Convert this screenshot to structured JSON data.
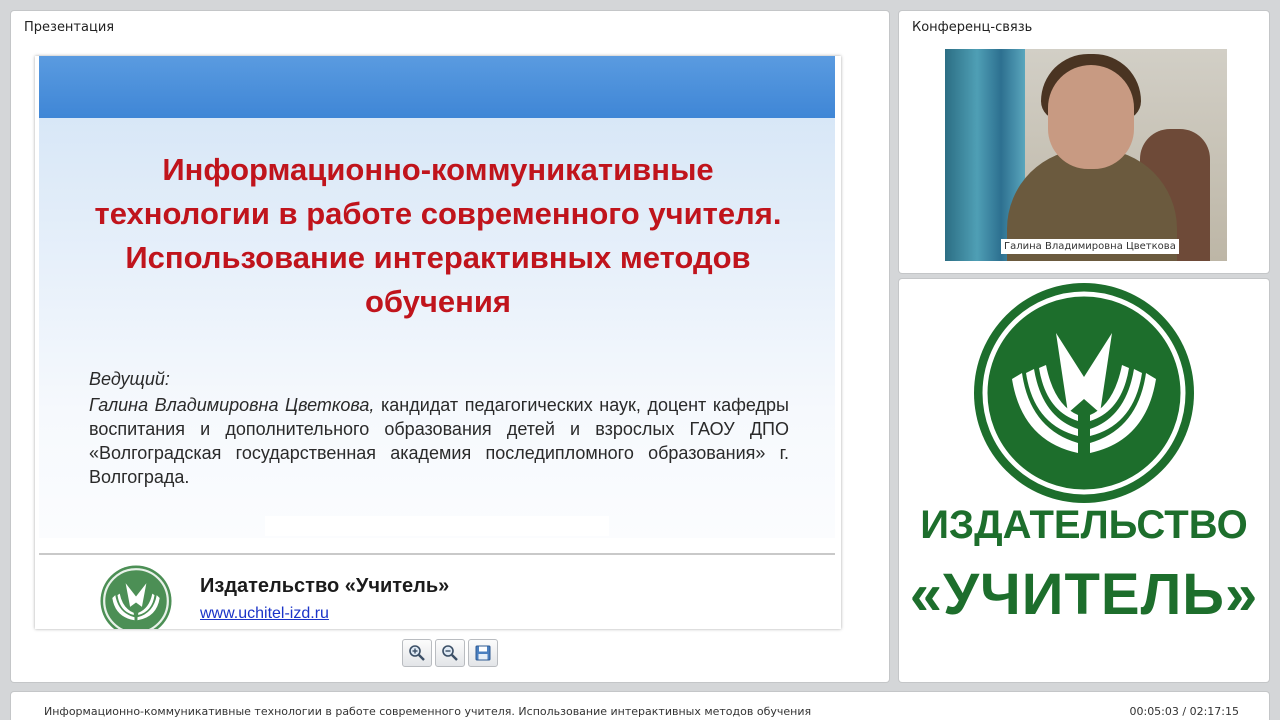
{
  "panels": {
    "presentation_title": "Презентация",
    "conference_title": "Конференц-связь"
  },
  "slide": {
    "title": "Информационно-коммуникативные технологии в работе современного учителя. Использование интерактивных методов обучения",
    "host_label": "Ведущий:",
    "host_name": "Галина Владимировна Цветкова,",
    "host_description": " кандидат педагогических наук, доцент кафедры воспитания и дополнительного образования детей и взрослых ГАОУ ДПО «Волгоградская государственная академия последипломного образования» г. Волгограда.",
    "publisher": "Издательство «Учитель»",
    "website": "www.uchitel-izd.ru"
  },
  "toolbar": {
    "zoom_in_icon": "zoom-in-icon",
    "zoom_out_icon": "zoom-out-icon",
    "save_icon": "save-icon"
  },
  "video": {
    "caption": "Галина Владимировна Цветкова"
  },
  "brand": {
    "line1": "ИЗДАТЕЛЬСТВО",
    "line2": "«УЧИТЕЛЬ»",
    "color": "#1d6e2c"
  },
  "status": {
    "title": "Информационно-коммуникативные технологии в работе современного учителя. Использование интерактивных методов обучения",
    "time": "00:05:03 / 02:17:15"
  }
}
